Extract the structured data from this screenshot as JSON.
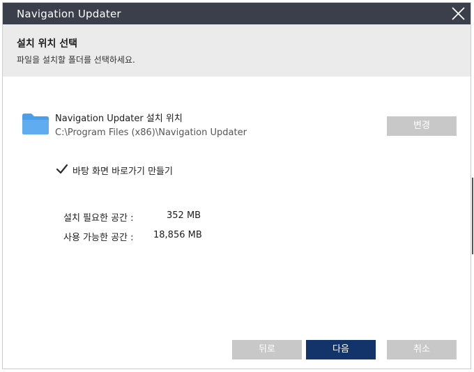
{
  "window": {
    "title": "Navigation Updater"
  },
  "header": {
    "title": "설치 위치 선택",
    "subtitle": "파일을 설치할 폴더를 선택하세요."
  },
  "location": {
    "title": "Navigation Updater 설치 위치",
    "path": "C:\\Program Files (x86)\\Navigation Updater",
    "change_label": "변경",
    "icon": "folder-icon"
  },
  "shortcut": {
    "label": "바탕 화면 바로가기 만들기",
    "checked": true
  },
  "space": {
    "required_label": "설치 필요한 공간 :",
    "required_value": "352 MB",
    "available_label": "사용 가능한 공간 :",
    "available_value": "18,856 MB"
  },
  "footer": {
    "back_label": "뒤로",
    "next_label": "다음",
    "cancel_label": "취소"
  },
  "colors": {
    "titlebar": "#3a3f4b",
    "header_bg": "#ebebeb",
    "primary_button": "#13346b",
    "disabled_button": "#c8c8c8",
    "folder": "#4a9eea"
  }
}
